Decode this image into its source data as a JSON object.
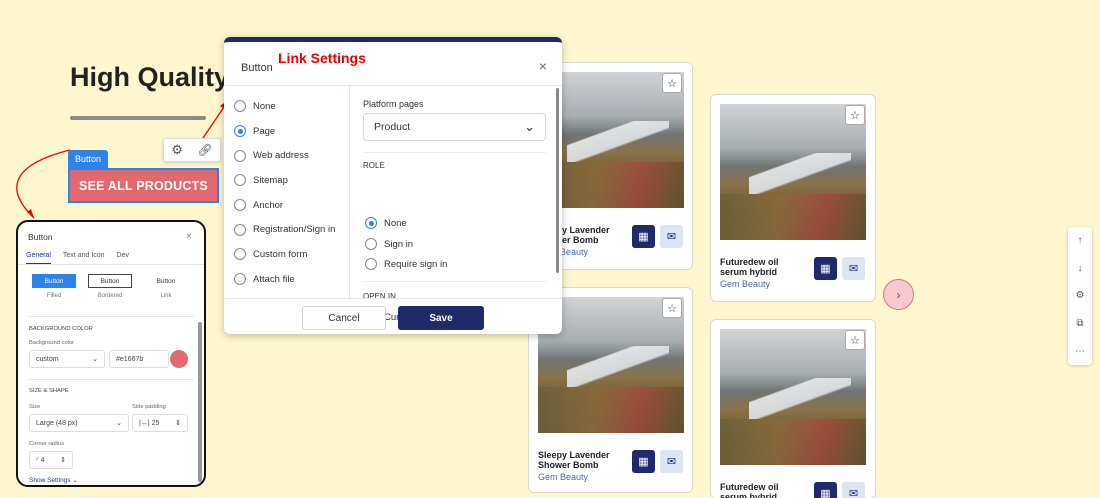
{
  "section": {
    "heading": "High Quality",
    "button_tag": "Button",
    "button_label": "SEE ALL PRODUCTS",
    "toolbar": {
      "settings_icon": "gear-icon",
      "link_icon": "link-icon"
    }
  },
  "annotation": {
    "label": "Link Settings",
    "color": "#ee0000"
  },
  "button_panel": {
    "title": "Button",
    "close": "×",
    "tabs": [
      "General",
      "Text and Icon",
      "Dev"
    ],
    "styles": [
      {
        "preview": "Button",
        "caption": "Filled"
      },
      {
        "preview": "Button",
        "caption": "Bordered"
      },
      {
        "preview": "Button",
        "caption": "Link"
      }
    ],
    "background_section": "BACKGROUND COLOR",
    "background_label": "Background color",
    "background_value": "custom",
    "background_hex": "#e1667b",
    "swatch_color": "#e06a6f",
    "size_section": "SIZE & SHAPE",
    "size_label": "Size",
    "size_value": "Large (48 px)",
    "padding_label": "Side padding",
    "padding_value": "25",
    "padding_prefix": "|↔|",
    "radius_label": "Corner radius",
    "radius_value": "4",
    "show_settings": "Show Settings"
  },
  "link_dialog": {
    "title": "Button",
    "close": "×",
    "options": [
      {
        "label": "None",
        "selected": false
      },
      {
        "label": "Page",
        "selected": true
      },
      {
        "label": "Web address",
        "selected": false
      },
      {
        "label": "Sitemap",
        "selected": false
      },
      {
        "label": "Anchor",
        "selected": false
      },
      {
        "label": "Registration/Sign in",
        "selected": false
      },
      {
        "label": "Custom form",
        "selected": false
      },
      {
        "label": "Attach file",
        "selected": false
      }
    ],
    "platform_label": "Platform pages",
    "platform_value": "Product",
    "role_label": "ROLE",
    "role_options": [
      {
        "label": "None",
        "selected": true
      },
      {
        "label": "Sign in",
        "selected": false
      },
      {
        "label": "Require sign in",
        "selected": false
      }
    ],
    "open_in_label": "OPEN IN",
    "open_in_option": "Current window",
    "cancel": "Cancel",
    "save": "Save"
  },
  "products": [
    {
      "name": "Sleepy Lavender Shower Bomb",
      "brand": "Gem Beauty"
    },
    {
      "name": "Futuredew oil serum hybrid",
      "brand": "Gem Beauty"
    },
    {
      "name": "Sleepy Lavender Shower Bomb",
      "brand": "Gem Beauty"
    },
    {
      "name": "Futuredew oil serum hybrid",
      "brand": ""
    }
  ],
  "side_tools": [
    "arrow-up-icon",
    "arrow-down-icon",
    "gear-icon",
    "duplicate-icon",
    "more-icon"
  ],
  "colors": {
    "background": "#fdf6cf",
    "accent": "#2f83e8",
    "primary": "#1f2a6b",
    "button": "#e06a6f"
  }
}
